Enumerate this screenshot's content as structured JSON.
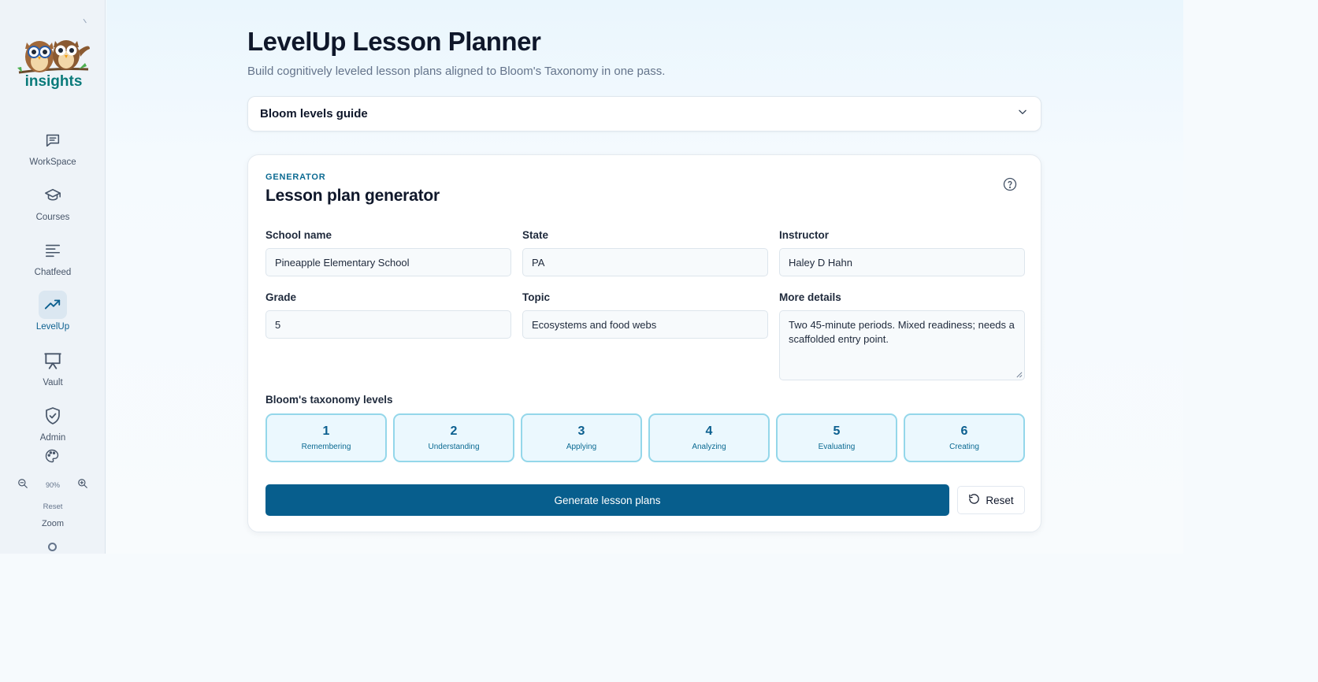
{
  "sidebar": {
    "logo_text": "insights",
    "items": [
      {
        "label": "WorkSpace",
        "icon": "chat-bubble-icon"
      },
      {
        "label": "Courses",
        "icon": "graduation-cap-icon"
      },
      {
        "label": "Chatfeed",
        "icon": "feed-lines-icon"
      },
      {
        "label": "LevelUp",
        "icon": "trending-up-icon",
        "active": true
      },
      {
        "label": "Vault",
        "icon": "presentation-board-icon"
      },
      {
        "label": "Admin",
        "icon": "shield-check-icon"
      }
    ],
    "zoom": {
      "percent": "90%",
      "reset_label": "Reset",
      "label": "Zoom"
    }
  },
  "header": {
    "title": "LevelUp Lesson Planner",
    "subtitle": "Build cognitively leveled lesson plans aligned to Bloom's Taxonomy in one pass."
  },
  "guide": {
    "label": "Bloom levels guide"
  },
  "generator": {
    "eyebrow": "GENERATOR",
    "title": "Lesson plan generator",
    "fields": {
      "school_label": "School name",
      "school_value": "Pineapple Elementary School",
      "state_label": "State",
      "state_value": "PA",
      "instructor_label": "Instructor",
      "instructor_value": "Haley D Hahn",
      "grade_label": "Grade",
      "grade_value": "5",
      "topic_label": "Topic",
      "topic_value": "Ecosystems and food webs",
      "details_label": "More details",
      "details_value": "Two 45-minute periods. Mixed readiness; needs a scaffolded entry point."
    },
    "bloom_label": "Bloom's taxonomy levels",
    "bloom_levels": [
      {
        "num": "1",
        "name": "Remembering"
      },
      {
        "num": "2",
        "name": "Understanding"
      },
      {
        "num": "3",
        "name": "Applying"
      },
      {
        "num": "4",
        "name": "Analyzing"
      },
      {
        "num": "5",
        "name": "Evaluating"
      },
      {
        "num": "6",
        "name": "Creating"
      }
    ],
    "generate_label": "Generate lesson plans",
    "reset_label": "Reset"
  },
  "colors": {
    "accent": "#075e8d",
    "bloom_bg": "#ebf8fe",
    "bloom_border": "#94d7ea"
  }
}
